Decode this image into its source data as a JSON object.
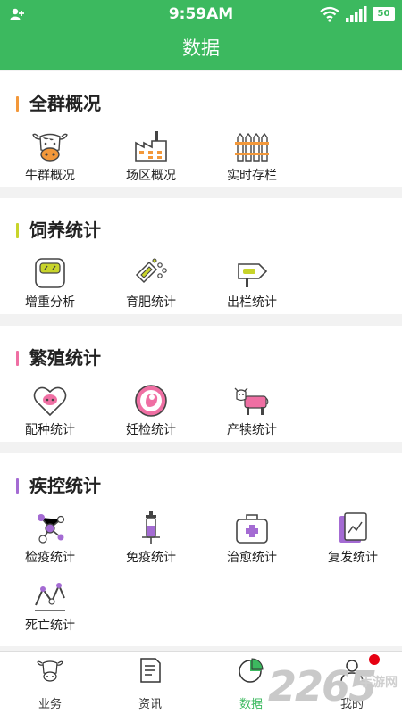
{
  "status_bar": {
    "time": "9:59AM",
    "battery": "50"
  },
  "header": {
    "title": "数据"
  },
  "colors": {
    "brand": "#3cb95f",
    "orange": "#f3983a",
    "yellow_green": "#c8d42a",
    "pink": "#ef6fa3",
    "purple": "#a46bd3"
  },
  "sections": [
    {
      "title": "全群概况",
      "items": [
        {
          "label": "牛群概况",
          "icon": "cow-face-icon"
        },
        {
          "label": "场区概况",
          "icon": "factory-icon"
        },
        {
          "label": "实时存栏",
          "icon": "fence-icon"
        }
      ]
    },
    {
      "title": "饲养统计",
      "items": [
        {
          "label": "增重分析",
          "icon": "scale-icon"
        },
        {
          "label": "育肥统计",
          "icon": "feed-bag-icon"
        },
        {
          "label": "出栏统计",
          "icon": "exit-sign-icon"
        }
      ]
    },
    {
      "title": "繁殖统计",
      "items": [
        {
          "label": "配种统计",
          "icon": "heart-icon"
        },
        {
          "label": "妊检统计",
          "icon": "pregnancy-icon"
        },
        {
          "label": "产犊统计",
          "icon": "calf-icon"
        }
      ]
    },
    {
      "title": "疾控统计",
      "items": [
        {
          "label": "检疫统计",
          "icon": "molecule-icon"
        },
        {
          "label": "免疫统计",
          "icon": "syringe-icon"
        },
        {
          "label": "治愈统计",
          "icon": "medical-kit-icon"
        },
        {
          "label": "复发统计",
          "icon": "report-icon"
        },
        {
          "label": "死亡统计",
          "icon": "line-trend-icon"
        }
      ]
    }
  ],
  "tabs": [
    {
      "label": "业务",
      "icon": "cow-icon"
    },
    {
      "label": "资讯",
      "icon": "news-icon"
    },
    {
      "label": "数据",
      "icon": "pie-chart-icon",
      "active": true
    },
    {
      "label": "我的",
      "icon": "user-icon"
    }
  ],
  "watermark": {
    "number": "2265",
    "text": "手游网"
  }
}
